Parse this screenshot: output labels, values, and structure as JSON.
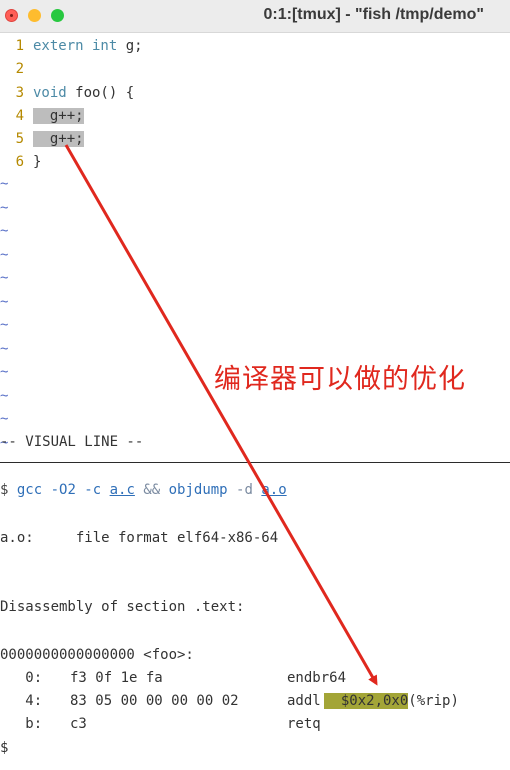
{
  "window": {
    "title": "0:1:[tmux] - \"fish /tmp/demo\"",
    "traffic_lights": [
      "close",
      "minimize",
      "zoom"
    ]
  },
  "editor": {
    "lines": [
      {
        "num": "1",
        "parts": [
          {
            "t": "extern int",
            "c": "kw"
          },
          {
            "t": " g;",
            "c": ""
          }
        ]
      },
      {
        "num": "2",
        "parts": []
      },
      {
        "num": "3",
        "parts": [
          {
            "t": "void",
            "c": "kw"
          },
          {
            "t": " foo() {",
            "c": ""
          }
        ]
      },
      {
        "num": "4",
        "parts": [
          {
            "t": "  g++;",
            "c": "sel"
          }
        ]
      },
      {
        "num": "5",
        "parts": [
          {
            "t": "  g++;",
            "c": "sel"
          }
        ]
      },
      {
        "num": "6",
        "parts": [
          {
            "t": "}",
            "c": ""
          }
        ]
      }
    ],
    "tilde": "~",
    "tilde_count": 12,
    "mode_status": "-- VISUAL LINE --"
  },
  "terminal": {
    "command": {
      "prompt": "$ ",
      "gcc": "gcc",
      "flags": " -O2 -c ",
      "file1": "a.c",
      "and": " && ",
      "objdump": "objdump",
      "flag_d": " -d ",
      "file2": "a.o"
    },
    "file_format_line": "a.o:     file format elf64-x86-64",
    "disasm_header": "Disassembly of section .text:",
    "symbol_line": "0000000000000000 <foo>:",
    "instructions": [
      {
        "addr": "   0:",
        "bytes": "f3 0f 1e fa",
        "mnemonic": "endbr64",
        "operand": "",
        "hl": ""
      },
      {
        "addr": "   4:",
        "bytes": "83 05 00 00 00 00 02",
        "mnemonic": "addl",
        "operand": "(%rip)",
        "hl": "  $0x2,0x0"
      },
      {
        "addr": "   b:",
        "bytes": "c3",
        "mnemonic": "retq",
        "operand": "",
        "hl": ""
      }
    ],
    "end_prompt": "$"
  },
  "annotation": {
    "text": "编译器可以做的优化",
    "color": "#e0281e"
  }
}
